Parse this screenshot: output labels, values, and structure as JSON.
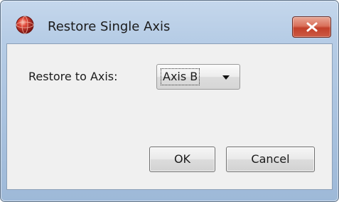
{
  "window": {
    "title": "Restore Single Axis",
    "icon": "app-red-sphere-icon",
    "close_icon": "close-x-icon"
  },
  "form": {
    "label": "Restore to Axis:",
    "axis_select": {
      "selected": "Axis B",
      "icon": "chevron-down-icon"
    }
  },
  "buttons": {
    "ok": "OK",
    "cancel": "Cancel"
  },
  "colors": {
    "close_button": "#c2402a",
    "title_bar": "#b7cde6",
    "client_bg": "#f0f0f0"
  }
}
